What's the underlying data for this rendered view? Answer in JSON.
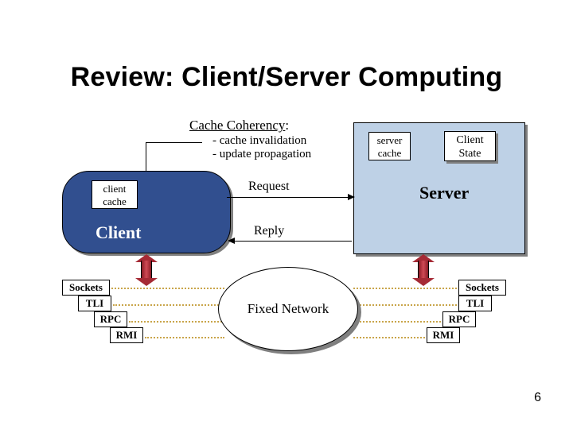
{
  "title": "Review: Client/Server Computing",
  "coherency": {
    "heading_underlined": "Cache Coherency",
    "heading_tail": ":",
    "line1": "- cache invalidation",
    "line2": "- update propagation"
  },
  "client": {
    "cache_l1": "client",
    "cache_l2": "cache",
    "label": "Client"
  },
  "server": {
    "cache_l1": "server",
    "cache_l2": "cache",
    "state_l1": "Client",
    "state_l2": "State",
    "label": "Server"
  },
  "arrows": {
    "request": "Request",
    "reply": "Reply"
  },
  "network_label": "Fixed Network",
  "stack_left": {
    "sockets": "Sockets",
    "tli": "TLI",
    "rpc": "RPC",
    "rmi": "RMI"
  },
  "stack_right": {
    "sockets": "Sockets",
    "tli": "TLI",
    "rpc": "RPC",
    "rmi": "RMI"
  },
  "page_number": "6"
}
